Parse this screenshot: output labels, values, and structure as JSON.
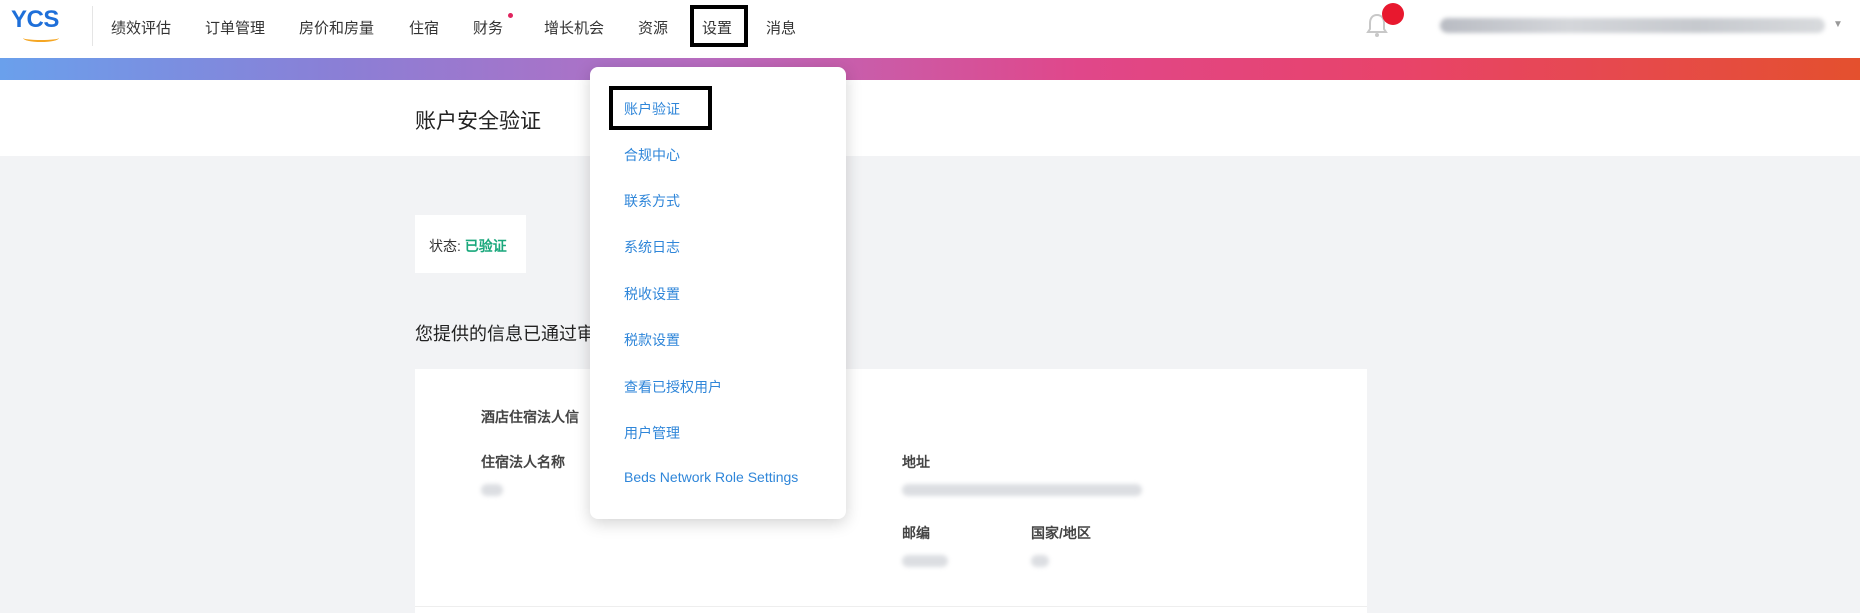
{
  "logo": {
    "text": "YCS"
  },
  "nav": {
    "items": [
      {
        "label": "绩效评估"
      },
      {
        "label": "订单管理"
      },
      {
        "label": "房价和房量"
      },
      {
        "label": "住宿"
      },
      {
        "label": "财务"
      },
      {
        "label": "增长机会"
      },
      {
        "label": "资源"
      },
      {
        "label": "设置"
      },
      {
        "label": "消息"
      }
    ]
  },
  "page": {
    "title": "账户安全验证",
    "status_label": "状态:",
    "status_value": "已验证",
    "info_line": "您提供的信息已通过审"
  },
  "card": {
    "section_title": "酒店住宿法人信",
    "name_label": "住宿法人名称",
    "address_label": "地址",
    "postcode_label": "邮编",
    "country_label": "国家/地区"
  },
  "dropdown": {
    "items": [
      {
        "label": "账户验证"
      },
      {
        "label": "合规中心"
      },
      {
        "label": "联系方式"
      },
      {
        "label": "系统日志"
      },
      {
        "label": "税收设置"
      },
      {
        "label": "税款设置"
      },
      {
        "label": "查看已授权用户"
      },
      {
        "label": "用户管理"
      },
      {
        "label": "Beds Network Role Settings"
      }
    ]
  },
  "colors": {
    "brand": "#1e6fd9",
    "link": "#2f86d9",
    "verified": "#1aa87c",
    "badge": "#e8182e"
  }
}
